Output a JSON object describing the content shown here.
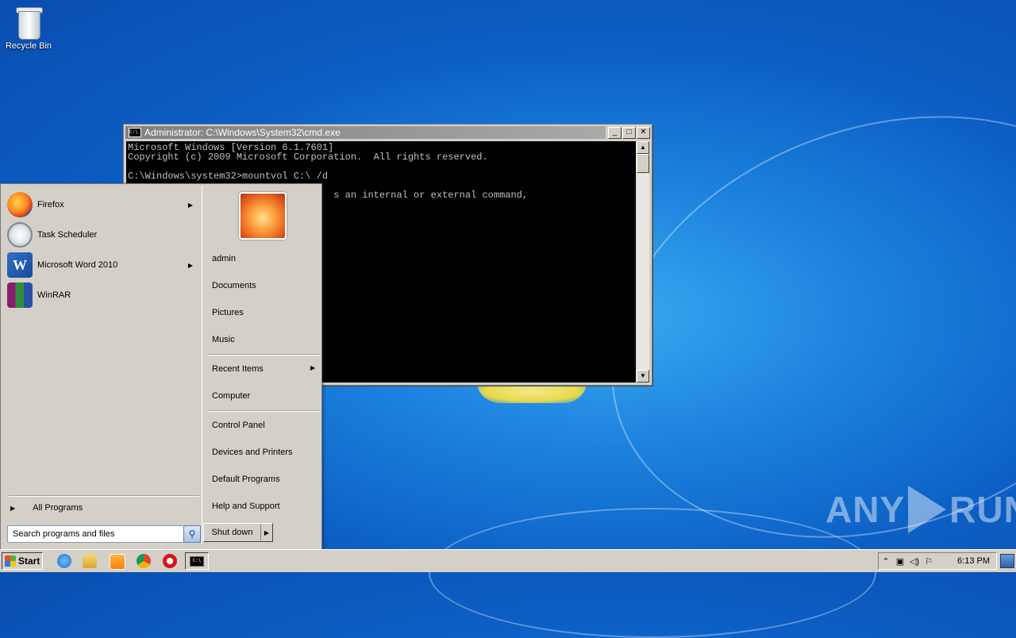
{
  "desktop": {
    "icons": [
      {
        "label": "Recycle Bin",
        "icon": "recycle-bin-icon"
      }
    ],
    "watermark": {
      "left": "ANY",
      "right": "RUN"
    }
  },
  "cmd_window": {
    "title": "Administrator: C:\\Windows\\System32\\cmd.exe",
    "icon_text": "C:\\",
    "buttons": {
      "minimize": "_",
      "maximize": "□",
      "close": "✕"
    },
    "lines": [
      "Microsoft Windows [Version 6.1.7601]",
      "Copyright (c) 2009 Microsoft Corporation.  All rights reserved.",
      "",
      "C:\\Windows\\system32>mountvol C:\\ /d",
      "",
      "                                    s an internal or external command,"
    ]
  },
  "start_menu": {
    "programs": [
      {
        "label": "Firefox",
        "icon": "firefox-icon",
        "has_arrow": true
      },
      {
        "label": "Task Scheduler",
        "icon": "task-scheduler-icon",
        "has_arrow": false
      },
      {
        "label": "Microsoft Word 2010",
        "icon": "word-icon",
        "has_arrow": true
      },
      {
        "label": "WinRAR",
        "icon": "winrar-icon",
        "has_arrow": false
      }
    ],
    "all_programs": "All Programs",
    "search_placeholder": "Search programs and files",
    "right_items": [
      {
        "label": "admin"
      },
      {
        "label": "Documents"
      },
      {
        "label": "Pictures"
      },
      {
        "label": "Music"
      },
      {
        "label": "Recent Items",
        "has_arrow": true
      },
      {
        "label": "Computer"
      },
      {
        "label": "Control Panel"
      },
      {
        "label": "Devices and Printers"
      },
      {
        "label": "Default Programs"
      },
      {
        "label": "Help and Support"
      }
    ],
    "shutdown_label": "Shut down"
  },
  "taskbar": {
    "start_label": "Start",
    "pinned": [
      "internet-explorer-icon",
      "windows-explorer-icon",
      "media-player-icon",
      "chrome-icon",
      "opera-icon"
    ],
    "active_app": "cmd-icon",
    "clock": "6:13 PM",
    "tray_icons": [
      "show-hidden-icons-icon",
      "network-icon",
      "volume-icon",
      "action-center-flag-icon"
    ]
  }
}
